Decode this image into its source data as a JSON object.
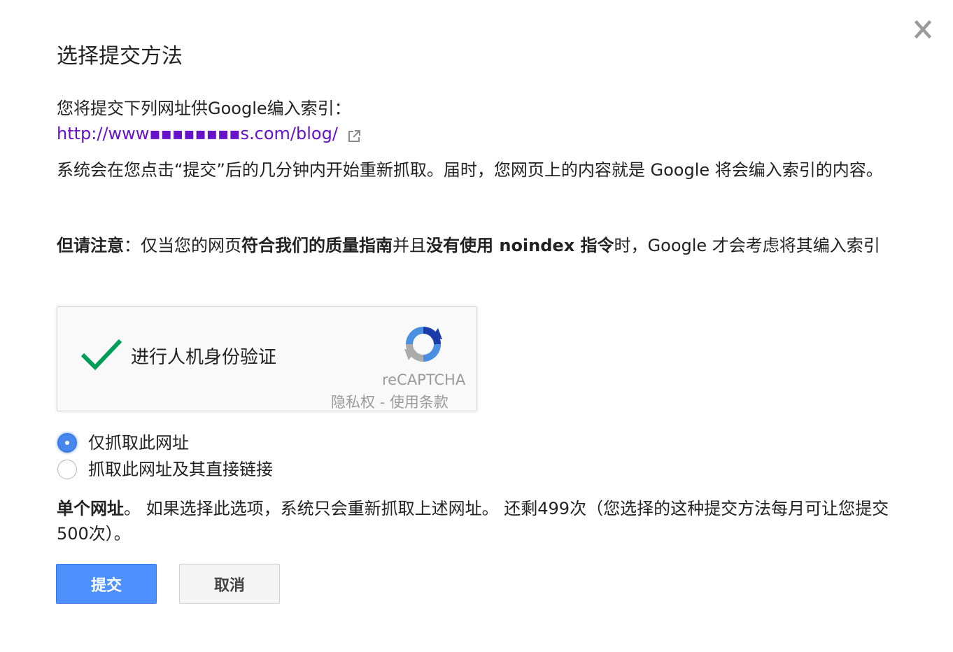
{
  "dialog": {
    "title": "选择提交方法",
    "close_icon": "close-icon"
  },
  "intro": {
    "text": "您将提交下列网址供Google编入索引：",
    "url": "http://www▪▪▪▪▪▪▪▪s.com/blog/",
    "external_icon": "external-link-icon"
  },
  "recrawl_text": "系统会在您点击“提交”后的几分钟内开始重新抓取。届时，您网页上的内容就是 Google 将会编入索引的内容。",
  "note": {
    "label": "但请注意",
    "text_1": "：仅当您的网页",
    "link_guidelines": "符合我们的质量指南",
    "text_2": "并且",
    "link_noindex": "没有使用 noindex 指令",
    "text_3": "时，Google 才会考虑将其编入索引"
  },
  "captcha": {
    "label": "进行人机身份验证",
    "brand": "reCAPTCHA",
    "privacy": "隐私权",
    "separator": " - ",
    "terms": "使用条款",
    "check_color": "#009e55",
    "status_icon": "checkmark-icon",
    "logo_icon": "recaptcha-logo-icon"
  },
  "options": [
    {
      "label": "仅抓取此网址",
      "selected": true
    },
    {
      "label": "抓取此网址及其直接链接",
      "selected": false
    }
  ],
  "single": {
    "label": "单个网址",
    "text": "。 如果选择此选项，系统只会重新抓取上述网址。 还剩499次（您选择的这种提交方法每月可让您提交500次）。"
  },
  "buttons": {
    "submit": "提交",
    "cancel": "取消"
  },
  "colors": {
    "link": "#6611cc",
    "primary": "#4d90fe",
    "radio": "#4787ed"
  }
}
